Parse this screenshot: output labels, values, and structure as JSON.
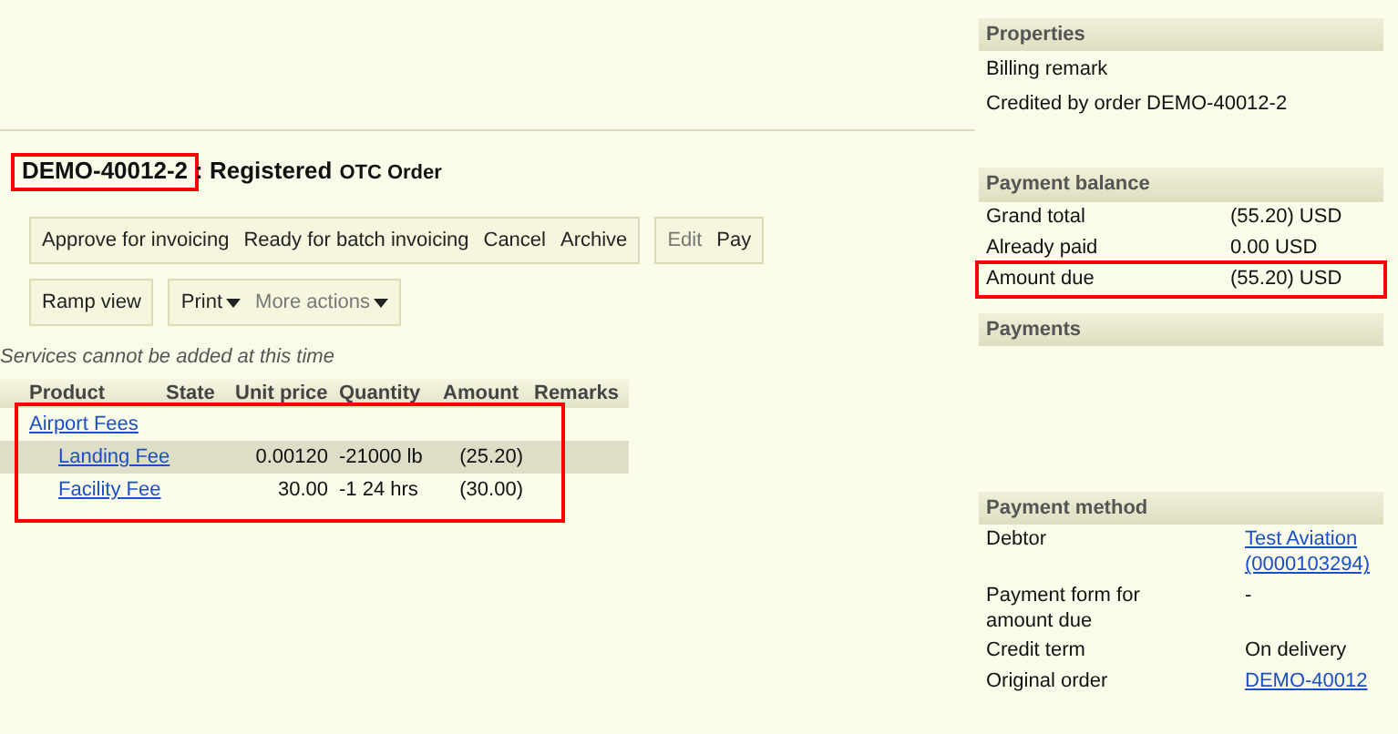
{
  "order": {
    "id": "DEMO-40012-2",
    "annotated": true,
    "status": ": Registered",
    "type": "OTC Order"
  },
  "action_rows": [
    [
      [
        {
          "label": "Approve for invoicing"
        },
        {
          "label": "Ready for batch invoicing"
        },
        {
          "label": "Cancel"
        },
        {
          "label": "Archive"
        }
      ],
      [
        {
          "label": "Edit",
          "disabled": true
        },
        {
          "label": "Pay"
        }
      ]
    ],
    [
      [
        {
          "label": "Ramp view"
        }
      ],
      [
        {
          "label": "Print",
          "dropdown": true
        },
        {
          "label": "More actions",
          "dropdown": true,
          "disabled": true
        }
      ]
    ]
  ],
  "notice": "Services cannot be added at this time",
  "table": {
    "columns": [
      "Product",
      "State",
      "Unit price",
      "Quantity",
      "Amount",
      "Remarks"
    ],
    "annotated": true,
    "rows": [
      {
        "kind": "group",
        "product": "Airport Fees",
        "selected": false
      },
      {
        "kind": "item",
        "product": "Landing Fee",
        "unit_price": "0.00120",
        "quantity": "-21000 lb",
        "amount": "(25.20)",
        "selected": true
      },
      {
        "kind": "item",
        "product": "Facility Fee",
        "unit_price": "30.00",
        "quantity": "-1 24 hrs",
        "amount": "(30.00)",
        "selected": false
      }
    ]
  },
  "properties": {
    "title": "Properties",
    "lines": [
      "Billing remark",
      "Credited by order DEMO-40012-2"
    ]
  },
  "payment_balance": {
    "title": "Payment balance",
    "rows": [
      {
        "label": "Grand total",
        "value": "(55.20) USD"
      },
      {
        "label": "Already paid",
        "value": "0.00 USD"
      },
      {
        "label": "Amount due",
        "value": "(55.20) USD",
        "annotated": true
      }
    ]
  },
  "payments": {
    "title": "Payments"
  },
  "payment_method": {
    "title": "Payment method",
    "rows": [
      {
        "label": "Debtor",
        "value": "Test Aviation (0000103294)",
        "link": true
      },
      {
        "label": "Payment form for amount due",
        "value": "-"
      },
      {
        "label": "Credit term",
        "value": "On delivery"
      },
      {
        "label": "Original order",
        "value": "DEMO-40012",
        "link": true
      }
    ]
  }
}
